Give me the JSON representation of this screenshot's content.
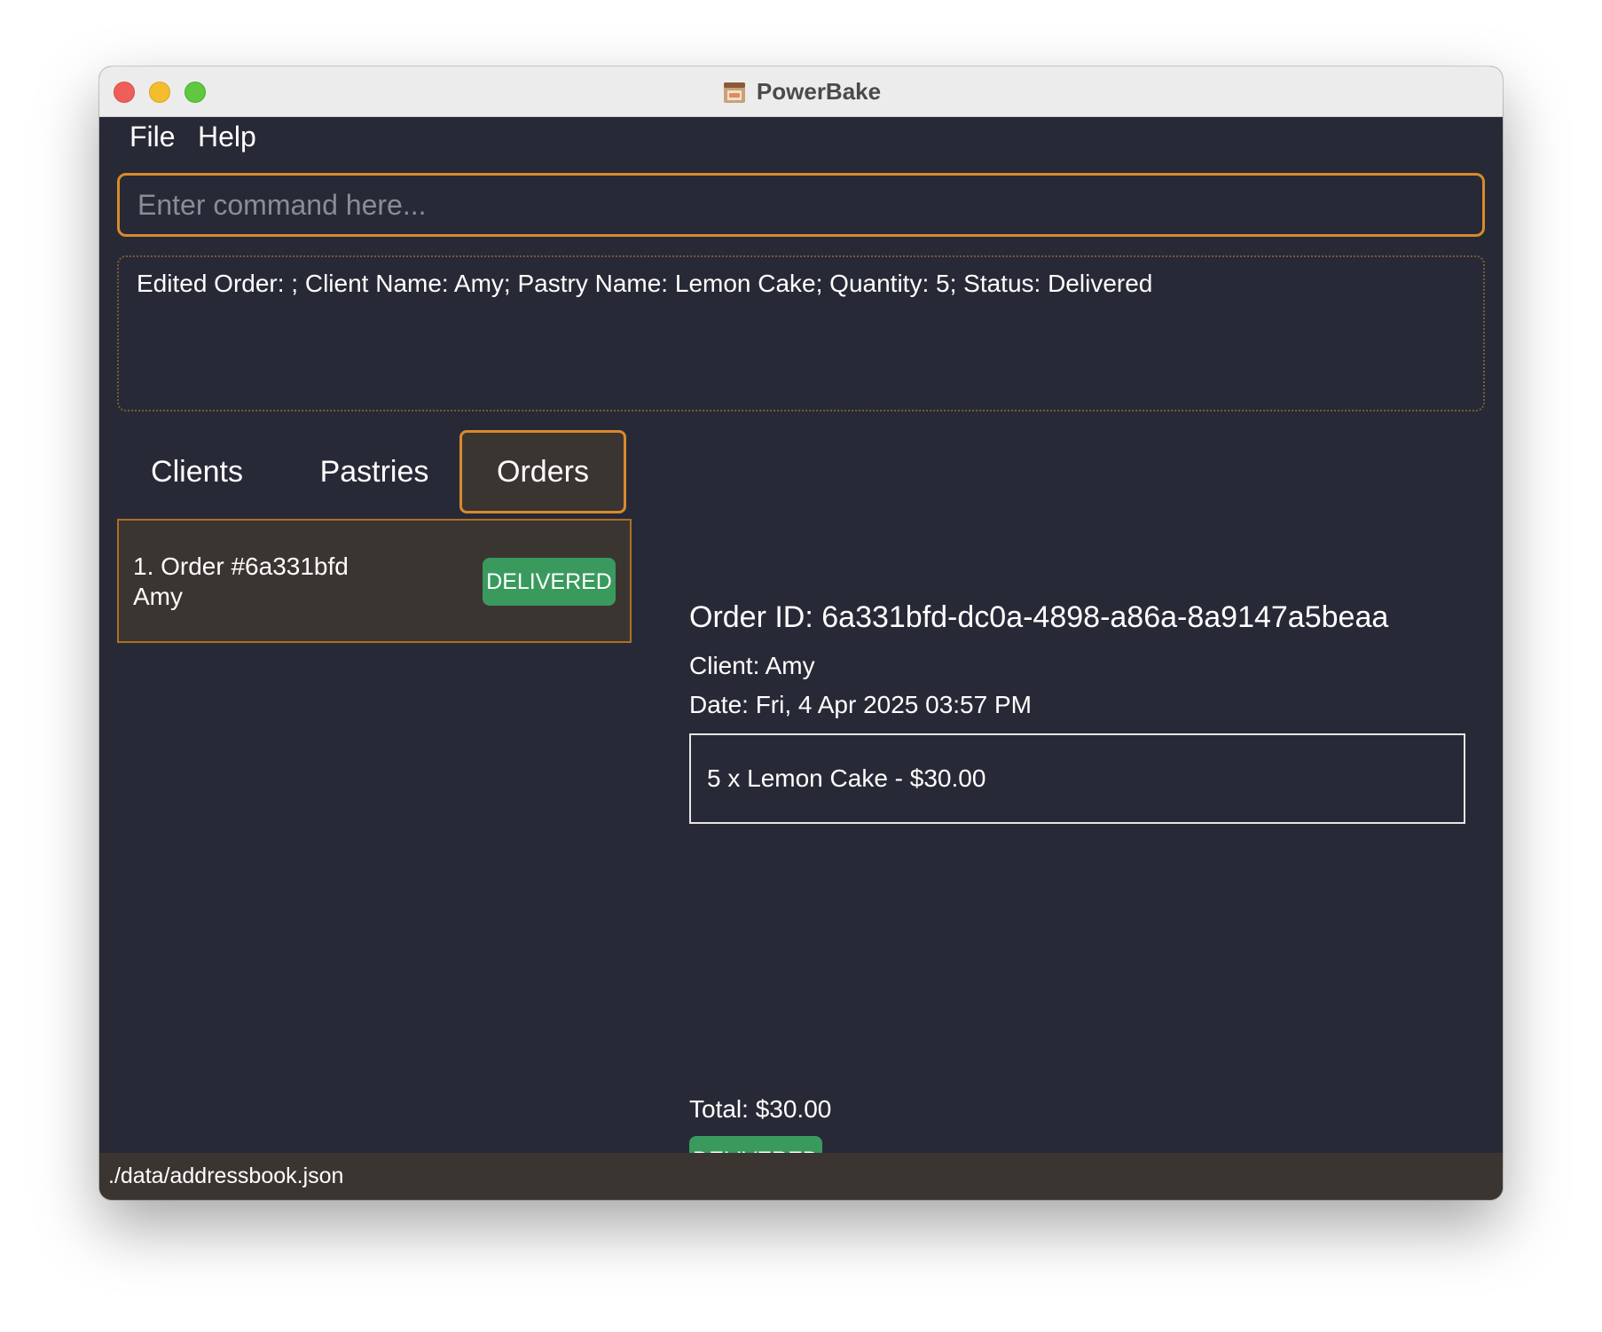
{
  "window": {
    "title": "PowerBake"
  },
  "menu": {
    "file_label": "File",
    "help_label": "Help"
  },
  "command": {
    "placeholder": "Enter command here..."
  },
  "result": {
    "text": "Edited Order: ; Client Name: Amy; Pastry Name: Lemon Cake; Quantity: 5; Status: Delivered"
  },
  "tabs": [
    {
      "label": "Clients",
      "selected": false
    },
    {
      "label": "Pastries",
      "selected": false
    },
    {
      "label": "Orders",
      "selected": true
    }
  ],
  "orders": [
    {
      "title": "1. Order #6a331bfd",
      "client": "Amy",
      "status": "DELIVERED"
    }
  ],
  "detail": {
    "order_id": "Order ID: 6a331bfd-dc0a-4898-a86a-8a9147a5beaa",
    "client": "Client: Amy",
    "date": "Date: Fri, 4 Apr 2025 03:57 PM",
    "items": [
      "5 x Lemon Cake - $30.00"
    ],
    "total": "Total: $30.00",
    "status": "DELIVERED"
  },
  "statusbar": {
    "path": "./data/addressbook.json"
  },
  "colors": {
    "background": "#272a36",
    "accent": "#d98a2c",
    "card_bg": "#3b3532",
    "status_delivered": "#3a9a5e"
  },
  "icons": {
    "app": "bakery-oven-icon"
  }
}
